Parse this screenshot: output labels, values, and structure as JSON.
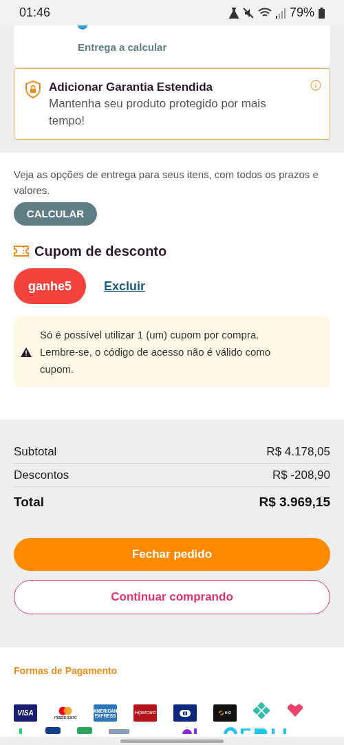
{
  "status_bar": {
    "time": "01:46",
    "battery": "79%"
  },
  "delivery_card": {
    "status": "Entrega a calcular"
  },
  "warranty": {
    "title": "Adicionar Garantia Estendida",
    "description": "Mantenha seu produto protegido por mais tempo!"
  },
  "shipping": {
    "text": "Veja as opções de entrega para seus itens, com todos os prazos e valores.",
    "button": "CALCULAR"
  },
  "coupon": {
    "title": "Cupom de desconto",
    "code": "ganhe5",
    "remove_link": "Excluir",
    "warning": "Só é possível utilizar 1 (um) cupom por compra. Lembre-se, o código de acesso não é válido como cupom."
  },
  "summary": {
    "rows": [
      {
        "label": "Subtotal",
        "value": "R$ 4.178,05"
      },
      {
        "label": "Descontos",
        "value": "R$ -208,90"
      }
    ],
    "total_label": "Total",
    "total_value": "R$ 3.969,15"
  },
  "buttons": {
    "primary": "Fechar pedido",
    "secondary": "Continuar comprando"
  },
  "payment": {
    "title": "Formas de Pagamento",
    "methods": [
      {
        "kind": "visa",
        "label": "VISA"
      },
      {
        "kind": "mastercard",
        "label": "mastercard"
      },
      {
        "kind": "amex",
        "label": "AMERICAN EXPRESS"
      },
      {
        "kind": "hipercard",
        "label": "Hipercard"
      },
      {
        "kind": "diners"
      },
      {
        "kind": "elo",
        "label": "elo"
      },
      {
        "kind": "pix"
      },
      {
        "kind": "heart"
      }
    ]
  }
}
